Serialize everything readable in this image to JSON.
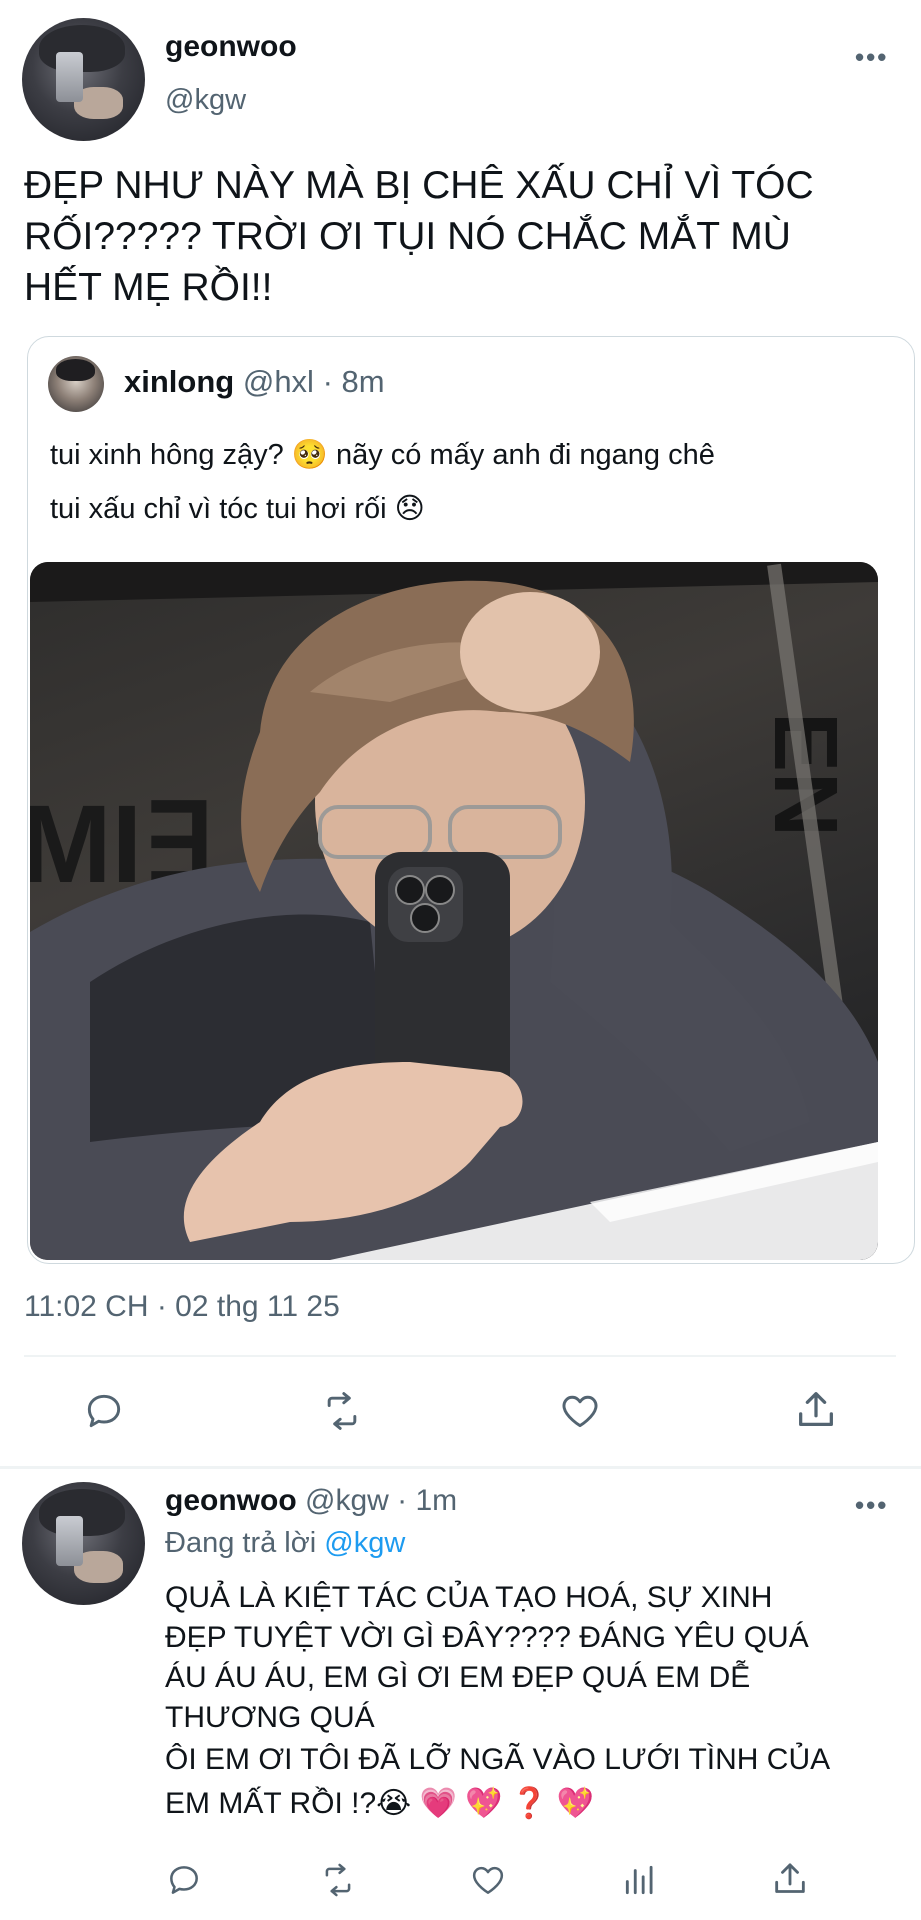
{
  "main_tweet": {
    "display_name": "geonwoo",
    "handle": "@kgw",
    "text_lines": [
      "ĐẸP NHƯ NÀY MÀ BỊ CHÊ XẤU CHỈ VÌ TÓC",
      "RỐI????? TRỜI ƠI TỤI NÓ CHẮC MẮT MÙ",
      "HẾT MẸ RỒI!!"
    ],
    "timestamp": "11:02 CH · 02 thg 11 25"
  },
  "quoted_tweet": {
    "display_name": "xinlong",
    "handle": "@hxl",
    "time": "· 8m",
    "text_lines": [
      "tui xinh hông zậy? 🥺 nãy có mấy anh đi ngang chê",
      "tui xấu chỉ vì tóc tui hơi rối 😞"
    ],
    "mirror_text_top": "EN",
    "mirror_text_side": "MI∃"
  },
  "reply_tweet": {
    "display_name": "geonwoo",
    "handle": "@kgw",
    "time": "· 1m",
    "replying_to_prefix": "Đang trả lời",
    "replying_to_handle": "@kgw",
    "text_lines": [
      "QUẢ LÀ KIỆT TÁC CỦA TẠO HOÁ, SỰ XINH",
      "ĐẸP TUYỆT VỜI GÌ ĐÂY???? ĐÁNG YÊU QUÁ",
      "ÁU ÁU ÁU, EM GÌ ƠI EM ĐẸP QUÁ EM DỄ",
      "THƯƠNG QUÁ",
      "ÔI EM ƠI TÔI ĐÃ LỠ NGÃ VÀO LƯỚI TÌNH CỦA",
      "EM MẤT RỒI !?😭 💗 💖 ❓ 💖"
    ]
  },
  "more_glyph": "•••",
  "icons": {
    "reply": "reply-icon",
    "retweet": "retweet-icon",
    "like": "heart-icon",
    "share": "share-icon",
    "views": "analytics-icon",
    "more": "more-icon"
  },
  "colors": {
    "text": "#0f1419",
    "muted": "#536471",
    "link": "#1d9bf0",
    "border": "#cfd9de",
    "icon": "#536471"
  }
}
